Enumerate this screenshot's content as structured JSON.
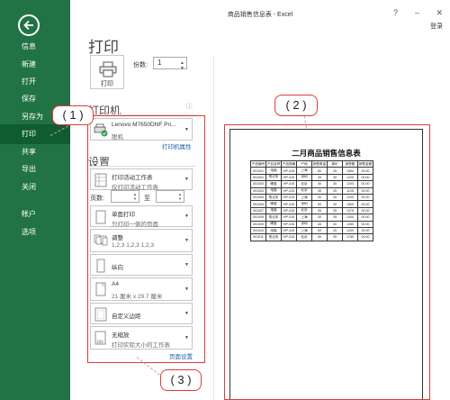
{
  "titlebar": {
    "title": "商品销售信息表 - Excel",
    "help": "?",
    "minimize": "–",
    "close": "✕",
    "login": "登录"
  },
  "sidebar": {
    "items": [
      "信息",
      "新建",
      "打开",
      "保存",
      "另存为",
      "打印",
      "共享",
      "导出",
      "关闭",
      "帐户",
      "选项"
    ],
    "active": "打印"
  },
  "main": {
    "title": "打印",
    "print_button": "打印",
    "copies_label": "份数:",
    "copies_value": "1"
  },
  "printer": {
    "heading": "打印机",
    "name": "Lenovo M7650DNF Pri...",
    "status": "脱机",
    "properties_link": "打印机属性",
    "info_icon": "ⓘ"
  },
  "settings": {
    "heading": "设置",
    "what": {
      "main": "打印活动工作表",
      "sub": "仅打印活动工作表"
    },
    "pages_label": "页数:",
    "to_label": "至",
    "sides": {
      "main": "单面打印",
      "sub": "只打印一侧的页面"
    },
    "collate": {
      "main": "调整",
      "sub": "1,2,3    1,2,3    1,2,3"
    },
    "orientation": {
      "main": "纵向"
    },
    "paper": {
      "main": "A4",
      "sub": "21 厘米 x 29.7 厘米"
    },
    "margins": {
      "main": "自定义边距"
    },
    "scaling": {
      "main": "无缩放",
      "sub": "打印实际大小的工作表"
    },
    "page_setup_link": "页面设置"
  },
  "preview": {
    "sheet_title": "二月商品销售信息表",
    "headers": [
      "产品编号",
      "产品名称",
      "产品规格",
      "产地",
      "销售数量",
      "单价",
      "销售额",
      "销售金额"
    ],
    "rows": [
      [
        "001001",
        "电脑",
        "HP-415",
        "上海",
        "60",
        "25",
        "1500",
        "00.00"
      ],
      [
        "001002",
        "笔记本",
        "HP-415",
        "深圳",
        "35",
        "35",
        "1225",
        "00.00"
      ],
      [
        "001003",
        "硬盘",
        "HP-415",
        "北京",
        "40",
        "30",
        "1200",
        "00.00"
      ],
      [
        "001004",
        "电脑",
        "HP-415",
        "北京",
        "45",
        "25",
        "1125",
        "00.00"
      ],
      [
        "001005",
        "笔记本",
        "HP-415",
        "上海",
        "30",
        "40",
        "1200",
        "00.00"
      ],
      [
        "001006",
        "硬盘",
        "HP-415",
        "深圳",
        "50",
        "30",
        "1500",
        "00.00"
      ],
      [
        "001007",
        "电脑",
        "HP-415",
        "北京",
        "55",
        "25",
        "1375",
        "00.00"
      ],
      [
        "001008",
        "笔记本",
        "HP-415",
        "上海",
        "40",
        "35",
        "1400",
        "00.00"
      ],
      [
        "001009",
        "硬盘",
        "HP-415",
        "深圳",
        "45",
        "30",
        "1350",
        "00.00"
      ],
      [
        "001010",
        "电脑",
        "HP-415",
        "上海",
        "60",
        "20",
        "1200",
        "00.00"
      ],
      [
        "001011",
        "笔记本",
        "HP-415",
        "北京",
        "50",
        "35",
        "1750",
        "00.00"
      ]
    ]
  },
  "annotations": {
    "one": "( 1 )",
    "two": "( 2 )",
    "three": "( 3 )"
  },
  "colors": {
    "sidebar": "#217346",
    "sidebar_active": "#0e5c2f",
    "annotation": "#e03a3a",
    "link": "#1f5fa8"
  }
}
